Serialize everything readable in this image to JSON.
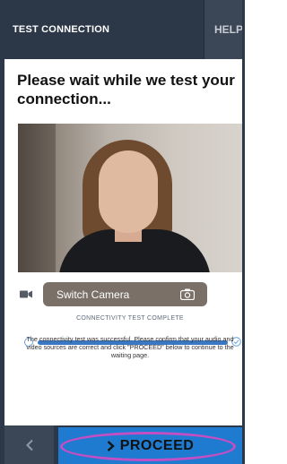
{
  "header": {
    "tab_test": "TEST CONNECTION",
    "tab_help": "HELP"
  },
  "main": {
    "heading": "Please wait while we test your connection...",
    "switch_camera_label": "Switch Camera"
  },
  "connectivity": {
    "title": "CONNECTIVITY TEST COMPLETE",
    "progress_percent": 100,
    "message": "The connectivity test was successful. Please confirm that your audio and video sources are correct and click \"PROCEED\" below to continue to the waiting page."
  },
  "footer": {
    "back_icon": "chevron-left-icon",
    "proceed_label": "PROCEED"
  },
  "colors": {
    "bar_bg": "#2c3747",
    "accent": "#1e7bd0",
    "progress": "#3a78c3",
    "highlight": "#c24fc4"
  }
}
